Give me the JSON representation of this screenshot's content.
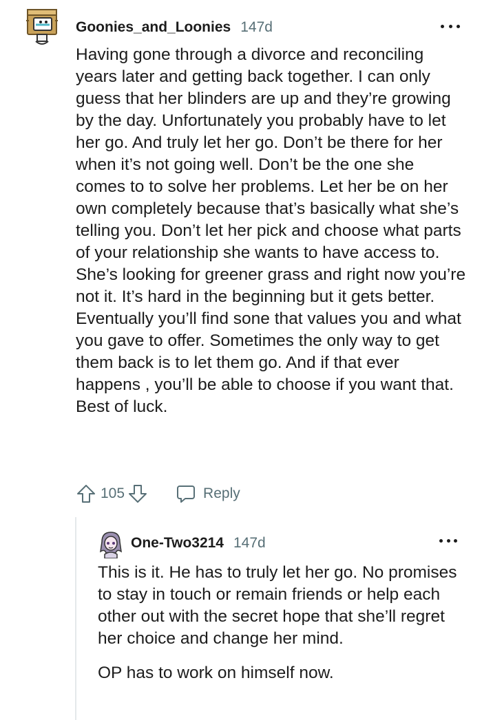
{
  "comment": {
    "author": "Goonies_and_Loonies",
    "age": "147d",
    "avatar_icon": "box-robot-avatar",
    "body": "Having gone through a divorce and reconciling years later and getting back together. I can only guess that her blinders are up and they’re growing by the day. Unfortunately you probably have to let her go. And truly let her go. Don’t be there for her when it’s not going well. Don’t be the one she comes to to solve her problems. Let her be on her own completely because that’s basically what she’s telling you. Don’t let her pick and choose what parts of your relationship she wants to have access to. She’s looking for greener grass and right now you’re not it. It’s hard in the beginning but it gets better. Eventually you’ll find sone that values you and what you gave to offer. Sometimes the only way to get them back is to let them go. And if that ever happens , you’ll be able to choose if you want that. Best of luck.",
    "score": "105",
    "reply_label": "Reply"
  },
  "reply": {
    "author": "One-Two3214",
    "age": "147d",
    "avatar_icon": "anime-character-avatar",
    "paragraphs": [
      "This is it. He has to truly let her go. No promises to stay in touch or remain friends or help each other out with the secret hope that she’ll regret her choice and change her mind.",
      "OP has to work on himself now."
    ]
  },
  "colors": {
    "text": "#1c1c1c",
    "meta": "#576f76",
    "thread_line": "#e4e8ea"
  }
}
